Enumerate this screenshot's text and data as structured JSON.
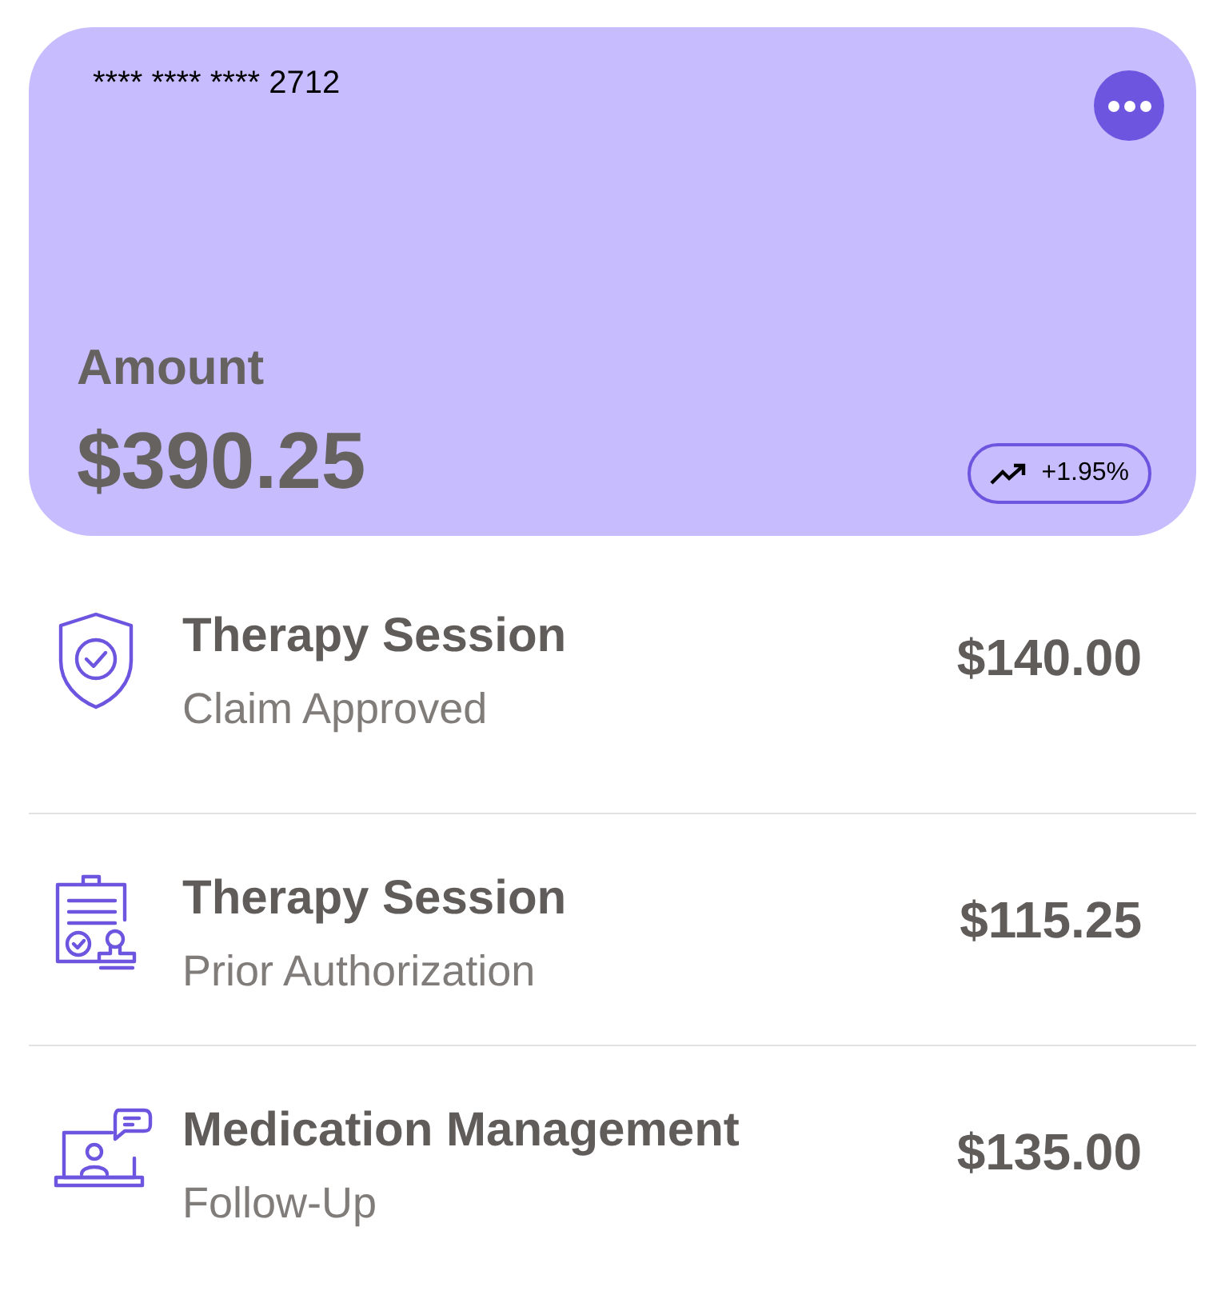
{
  "card": {
    "number": "**** **** **** 2712",
    "label": "Amount",
    "amount": "$390.25",
    "change": "+1.95%"
  },
  "items": [
    {
      "kind": "shield",
      "title": "Therapy Session",
      "subtitle": "Claim Approved",
      "amount": "$140.00"
    },
    {
      "kind": "clipboard",
      "title": "Therapy Session",
      "subtitle": "Prior Authorization",
      "amount": "$115.25"
    },
    {
      "kind": "laptop",
      "title": "Medication Management",
      "subtitle": "Follow-Up",
      "amount": "$135.00"
    }
  ]
}
